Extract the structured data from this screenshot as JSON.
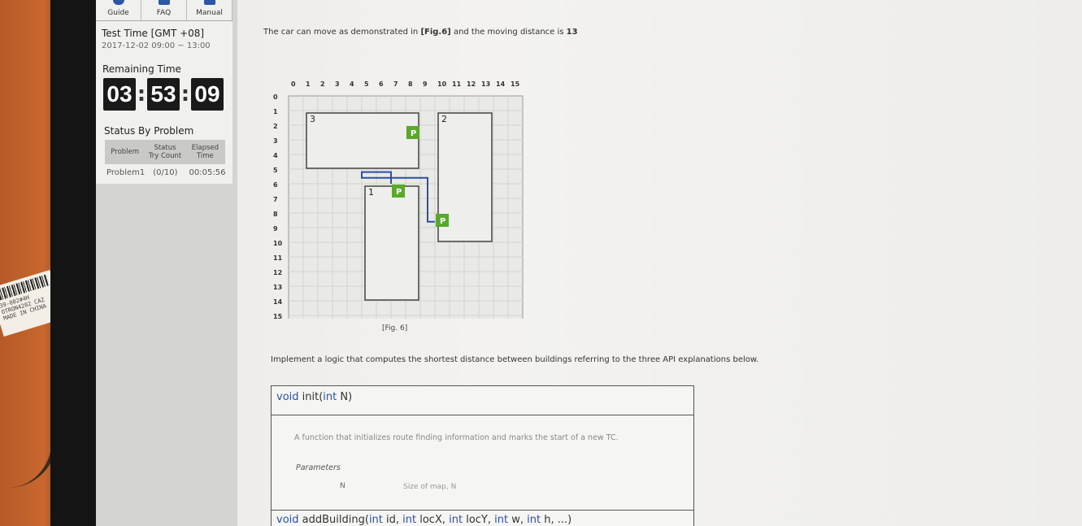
{
  "nav": {
    "guide": "Guide",
    "faq": "FAQ",
    "manual": "Manual"
  },
  "test": {
    "label": "Test Time [GMT +08]",
    "range": "2017-12-02 09:00 ~ 13:00"
  },
  "remaining": {
    "label": "Remaining Time",
    "hours": "03",
    "minutes": "53",
    "seconds": "09"
  },
  "status": {
    "title": "Status By Problem",
    "col_problem": "Problem",
    "col_status": "Status",
    "col_status2": "Try Count",
    "col_elapsed": "Elapsed",
    "col_elapsed2": "Time",
    "row_name": "Problem1",
    "row_count": "(0/10)",
    "row_time": "00:05:56"
  },
  "content": {
    "intro_pre": "The car can move as demonstrated in ",
    "intro_ref": "[Fig.6]",
    "intro_post": " and the moving distance is ",
    "intro_num": "13",
    "caption": "[Fig. 6]",
    "impl": "Implement a logic that computes the shortest distance between buildings referring to the three API explanations below."
  },
  "figure": {
    "col_labels": [
      "0",
      "1",
      "2",
      "3",
      "4",
      "5",
      "6",
      "7",
      "8",
      "9",
      "10",
      "11",
      "12",
      "13",
      "14",
      "15"
    ],
    "row_labels": [
      "0",
      "1",
      "2",
      "3",
      "4",
      "5",
      "6",
      "7",
      "8",
      "9",
      "10",
      "11",
      "12",
      "13",
      "14",
      "15"
    ],
    "buildings": [
      {
        "id": "3",
        "x": 1,
        "y": 1,
        "w": 8,
        "h": 4
      },
      {
        "id": "2",
        "x": 10,
        "y": 1,
        "w": 4,
        "h": 9
      },
      {
        "id": "1",
        "x": 5,
        "y": 6,
        "w": 4,
        "h": 8
      }
    ],
    "parking": [
      {
        "label": "P",
        "x": 8,
        "y": 2
      },
      {
        "label": "P",
        "x": 7,
        "y": 6
      },
      {
        "label": "P",
        "x": 10,
        "y": 8
      }
    ],
    "path_color": "#2b4fa8",
    "parking_color": "#5aa82c"
  },
  "api": {
    "init_ret": "void",
    "init_name": " init(",
    "init_type": "int",
    "init_arg": " N)",
    "init_desc": "A function that initializes route finding information and marks the start of a new TC.",
    "params_label": "Parameters",
    "param_name": "N",
    "param_desc": "Size of map, N",
    "add_ret": "void",
    "add_name": " addBuilding(",
    "add_t1": "int",
    "add_a1": " id, ",
    "add_t2": "int",
    "add_a2": " locX, ",
    "add_t3": "int",
    "add_a3": " locY, ",
    "add_t4": "int",
    "add_a4": " w, ",
    "add_t5": "int",
    "add_a5": " h, ...)"
  },
  "sticker": {
    "line1": "39-002#4H",
    "line2": "OTRON4202 CAZ",
    "line3": "MADE IN CHINA"
  }
}
